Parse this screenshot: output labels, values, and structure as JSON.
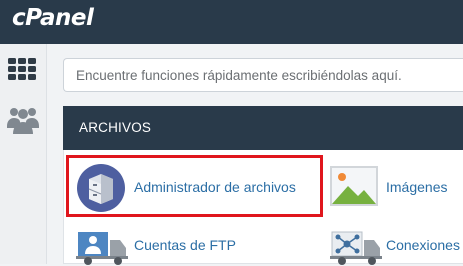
{
  "header": {
    "logo_text": "cPanel"
  },
  "leftnav": {
    "items": [
      {
        "icon": "grid-icon"
      },
      {
        "icon": "users-icon"
      }
    ]
  },
  "search": {
    "placeholder": "Encuentre funciones rápidamente escribiéndolas aquí."
  },
  "section": {
    "title": "ARCHIVOS",
    "items": [
      {
        "label": "Administrador de archivos",
        "icon": "file-cabinet-icon",
        "highlighted": true
      },
      {
        "label": "Imágenes",
        "icon": "image-icon"
      },
      {
        "label": "Cuentas de FTP",
        "icon": "ftp-truck-icon"
      },
      {
        "label": "Conexiones",
        "icon": "network-truck-icon"
      }
    ]
  },
  "colors": {
    "header_bg": "#293a4a",
    "link": "#2b6ea5",
    "highlight_border": "#e0161d"
  }
}
